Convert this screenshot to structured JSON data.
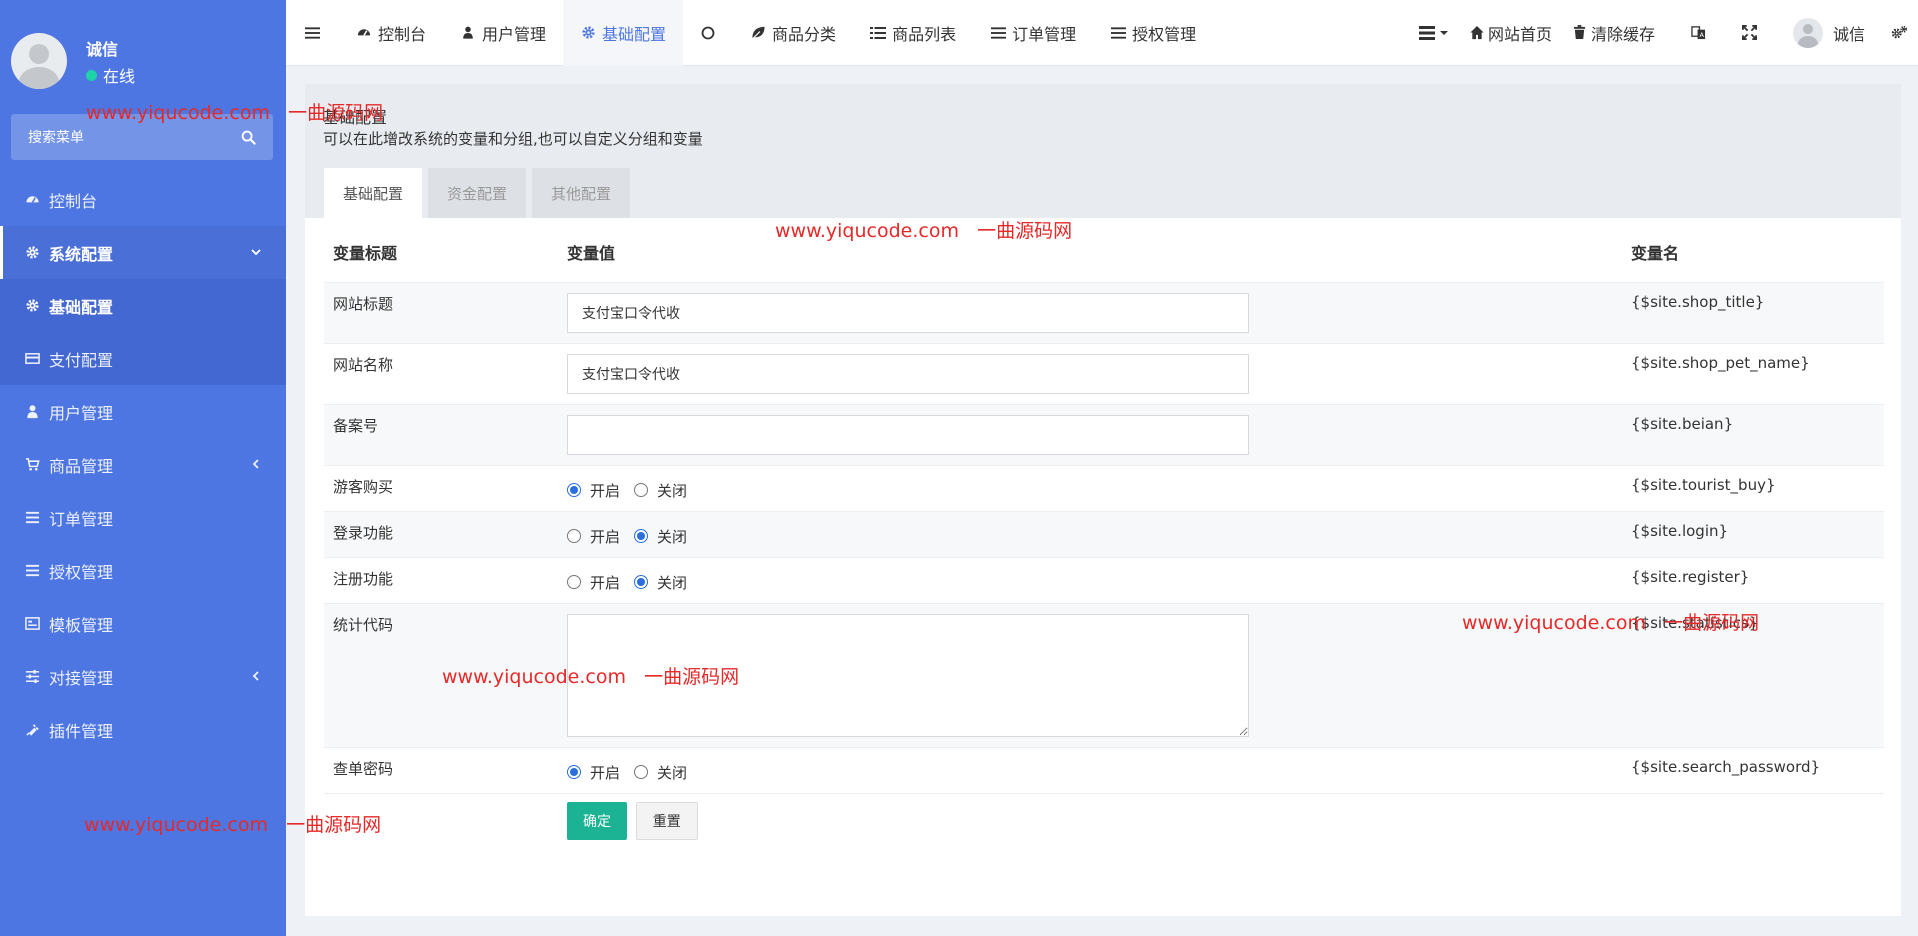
{
  "user": {
    "name": "诚信",
    "status": "在线"
  },
  "sidebar": {
    "search_placeholder": "搜索菜单",
    "items": [
      {
        "label": "控制台",
        "icon": "dashboard-icon"
      },
      {
        "label": "系统配置",
        "icon": "gear-icon",
        "expanded": true,
        "children": [
          {
            "label": "基础配置",
            "icon": "gear-icon",
            "active": true
          },
          {
            "label": "支付配置",
            "icon": "card-icon"
          }
        ]
      },
      {
        "label": "用户管理",
        "icon": "user-icon"
      },
      {
        "label": "商品管理",
        "icon": "cart-icon"
      },
      {
        "label": "订单管理",
        "icon": "list-icon"
      },
      {
        "label": "授权管理",
        "icon": "list-icon"
      },
      {
        "label": "模板管理",
        "icon": "template-icon"
      },
      {
        "label": "对接管理",
        "icon": "sliders-icon"
      },
      {
        "label": "插件管理",
        "icon": "plug-icon"
      }
    ]
  },
  "topbar": {
    "tabs": [
      "控制台",
      "用户管理",
      "基础配置",
      "",
      "商品分类",
      "商品列表",
      "订单管理",
      "授权管理"
    ],
    "active_tab": "基础配置",
    "right": {
      "home": "网站首页",
      "clear_cache": "清除缓存",
      "user": "诚信"
    }
  },
  "page": {
    "title": "基础配置",
    "description": "可以在此增改系统的变量和分组,也可以自定义分组和变量",
    "tabs": [
      "基础配置",
      "资金配置",
      "其他配置"
    ]
  },
  "table": {
    "headers": [
      "变量标题",
      "变量值",
      "变量名"
    ],
    "rows": [
      {
        "title": "网站标题",
        "type": "text",
        "value": "支付宝口令代收",
        "var": "{$site.shop_title}"
      },
      {
        "title": "网站名称",
        "type": "text",
        "value": "支付宝口令代收",
        "var": "{$site.shop_pet_name}"
      },
      {
        "title": "备案号",
        "type": "text",
        "value": "",
        "var": "{$site.beian}"
      },
      {
        "title": "游客购买",
        "type": "radio",
        "options": [
          "开启",
          "关闭"
        ],
        "selected": "开启",
        "var": "{$site.tourist_buy}"
      },
      {
        "title": "登录功能",
        "type": "radio",
        "options": [
          "开启",
          "关闭"
        ],
        "selected": "关闭",
        "var": "{$site.login}"
      },
      {
        "title": "注册功能",
        "type": "radio",
        "options": [
          "开启",
          "关闭"
        ],
        "selected": "关闭",
        "var": "{$site.register}"
      },
      {
        "title": "统计代码",
        "type": "textarea",
        "value": "",
        "var": "{$site.statistics}"
      },
      {
        "title": "查单密码",
        "type": "radio",
        "options": [
          "开启",
          "关闭"
        ],
        "selected": "开启",
        "var": "{$site.search_password}"
      }
    ],
    "submit_label": "确定",
    "reset_label": "重置"
  },
  "watermark": {
    "site": "www.yiqucode.com",
    "name": "一曲源码网"
  },
  "colors": {
    "sidebar": "#4e76e2",
    "accent": "#4e76e2",
    "primary_button": "#1bb394",
    "watermark": "#e52929"
  }
}
